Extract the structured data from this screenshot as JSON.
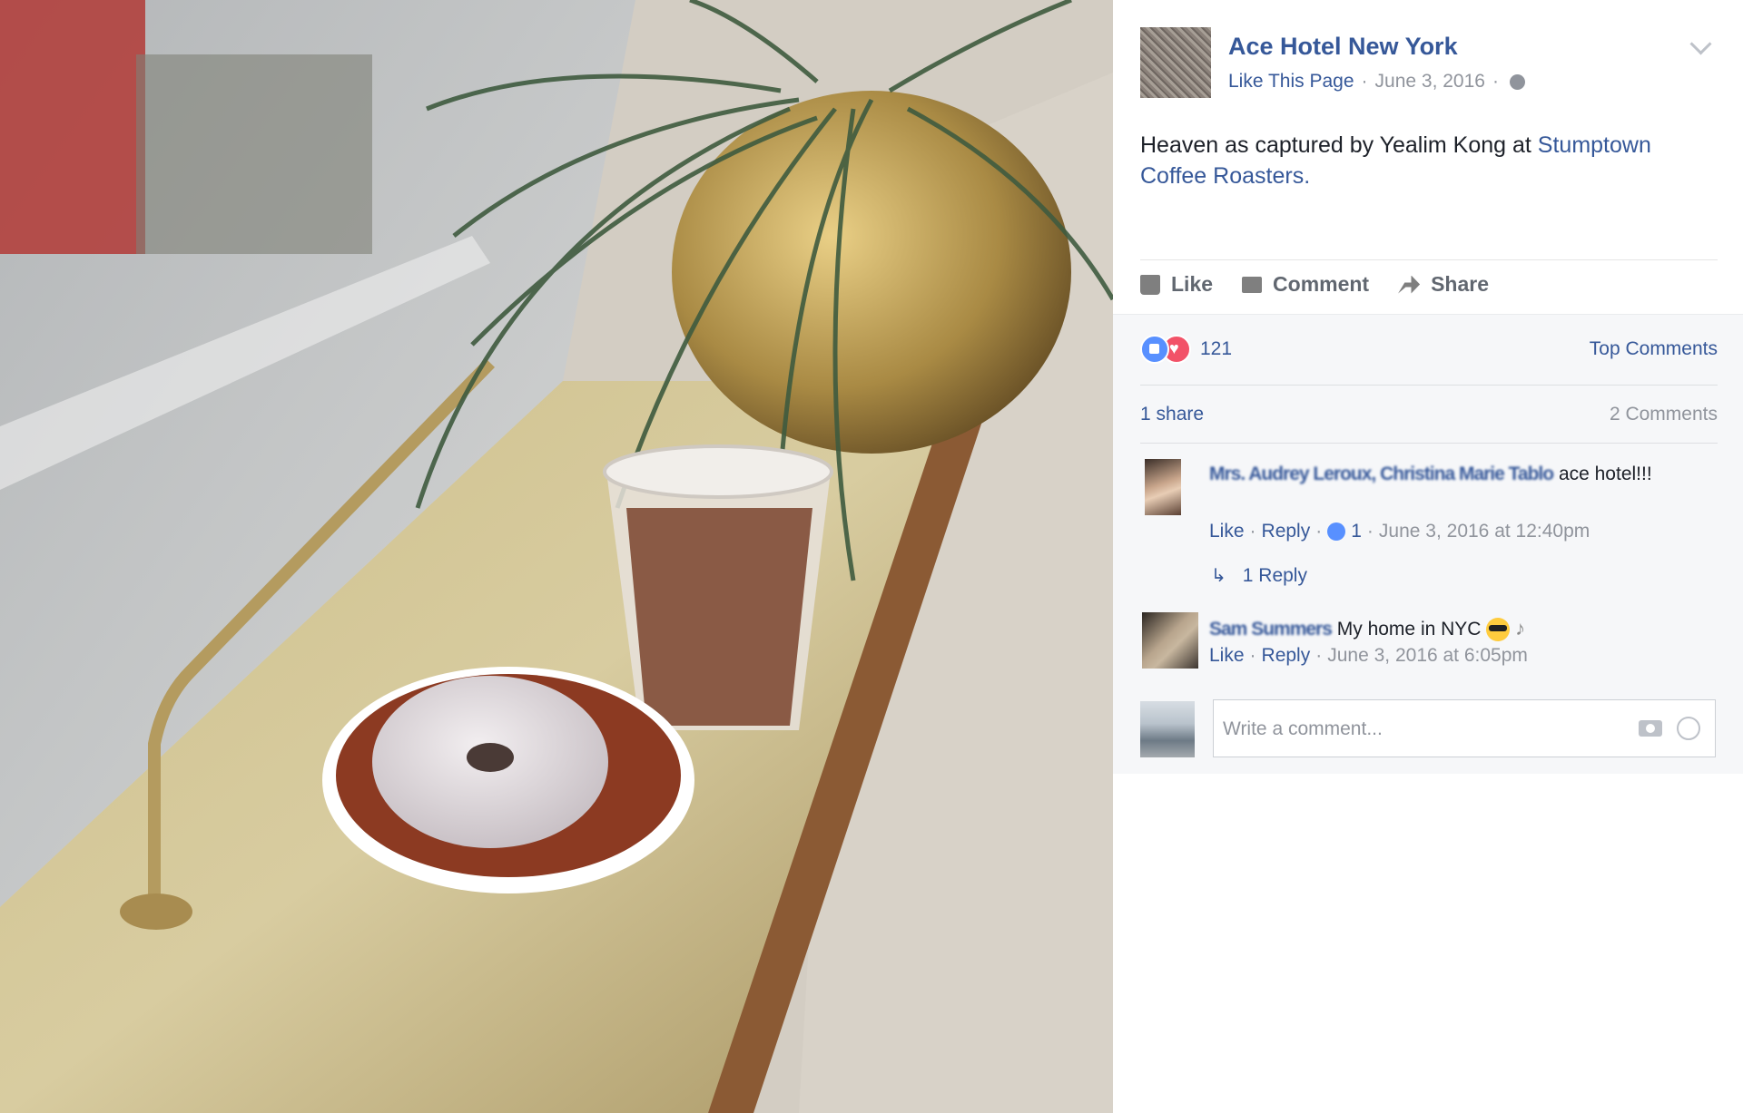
{
  "post": {
    "page_name": "Ace Hotel New York",
    "like_page": "Like This Page",
    "date": "June 3, 2016",
    "caption_text": "Heaven as captured by Yealim Kong at ",
    "caption_mention": "Stumptown Coffee Roasters.",
    "actions": {
      "like": "Like",
      "comment": "Comment",
      "share": "Share"
    }
  },
  "stats": {
    "reaction_count": "121",
    "sort_label": "Top Comments",
    "shares": "1 share",
    "comments": "2 Comments"
  },
  "comments": [
    {
      "author": "Mrs. Audrey Leroux, Christina Marie Tablo",
      "text": "ace hotel!!!",
      "like": "Like",
      "reply": "Reply",
      "like_count": "1",
      "timestamp": "June 3, 2016 at 12:40pm",
      "replies": "1 Reply"
    },
    {
      "author": "Sam Summers",
      "text": "My home in NYC",
      "like": "Like",
      "reply": "Reply",
      "timestamp": "June 3, 2016 at 6:05pm"
    }
  ],
  "composer": {
    "placeholder": "Write a comment..."
  },
  "icons": [
    "globe-icon",
    "chevron-down-icon",
    "like-icon",
    "comment-icon",
    "share-icon",
    "reply-arrow-icon",
    "camera-icon",
    "smiley-icon"
  ],
  "colors": {
    "link": "#365899",
    "muted": "#90949c",
    "panel_gray": "#f6f7f9"
  }
}
